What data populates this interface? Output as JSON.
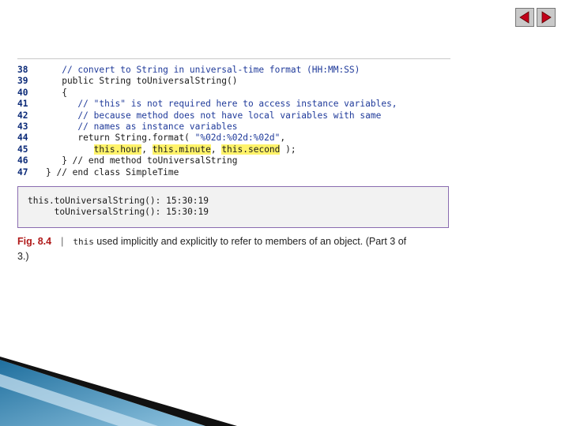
{
  "nav": {
    "prev_icon": "triangle-left",
    "next_icon": "triangle-right",
    "button_color": "#c9c9c9",
    "arrow_color": "#c2001a"
  },
  "code": {
    "lines": [
      {
        "no": "38",
        "text": "   // convert to String in universal-time format (HH:MM:SS)"
      },
      {
        "no": "39",
        "text": "   public String toUniversalString()"
      },
      {
        "no": "40",
        "text": "   {"
      },
      {
        "no": "41",
        "text": "      // \"this\" is not required here to access instance variables,"
      },
      {
        "no": "42",
        "text": "      // because method does not have local variables with same"
      },
      {
        "no": "43",
        "text": "      // names as instance variables"
      },
      {
        "no": "44",
        "pre": "      return String.format( ",
        "str": "\"%02d:%02d:%02d\"",
        "post": ","
      },
      {
        "no": "45",
        "indent": "         ",
        "h1": "this.hour",
        "c1": ", ",
        "h2": "this.minute",
        "c2": ", ",
        "h3": "this.second",
        "end": " );"
      },
      {
        "no": "46",
        "text": "   } // end method toUniversalString"
      },
      {
        "no": "47",
        "text": "} // end class SimpleTime"
      }
    ]
  },
  "output": {
    "lines": [
      "this.toUniversalString(): 15:30:19",
      "     toUniversalString(): 15:30:19"
    ]
  },
  "caption": {
    "label": "Fig. 8.4",
    "separator": "|",
    "code_word": "this",
    "text": " used implicitly and explicitly to refer to members of an object. (Part 3 of 3.)"
  },
  "colors": {
    "highlight": "#fff36a",
    "line_numbers": "#0b2a78",
    "output_border": "#8a6cb0",
    "fig_label": "#b01a1a"
  }
}
